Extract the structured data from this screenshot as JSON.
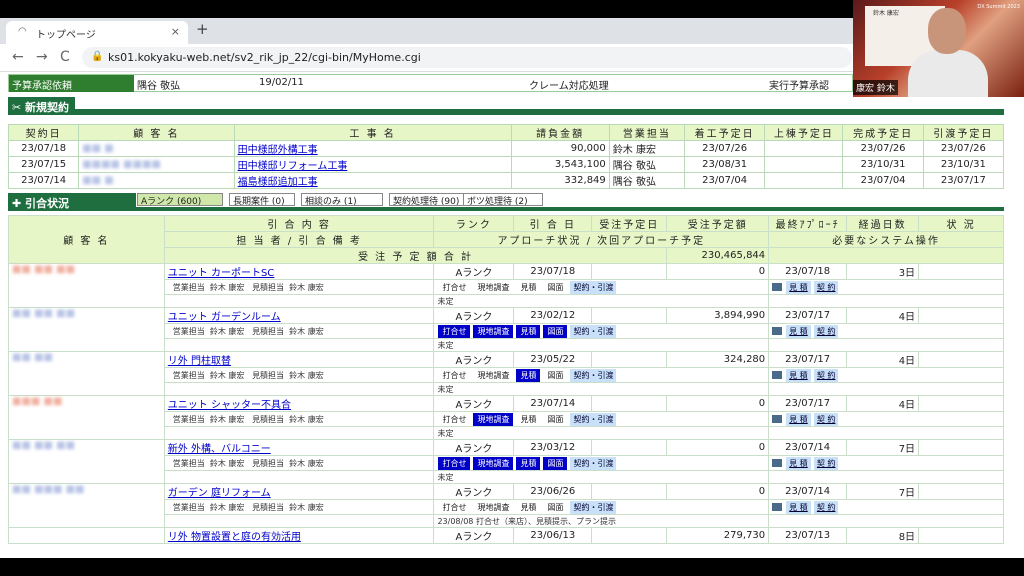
{
  "browser": {
    "tab_title": "トップページ",
    "url": "ks01.kokyaku-web.net/sv2_rik_jp_22/cgi-bin/MyHome.cgi",
    "new_tab": "+",
    "close": "×",
    "back": "←",
    "forward": "→",
    "reload": "C",
    "lock": "🔒"
  },
  "video": {
    "name": "康宏 鈴木",
    "panel_name": "鈴木 康宏",
    "event": "DX Summit 2023"
  },
  "approval_row": {
    "label": "予算承認依頼",
    "name": "隅谷 敬弘",
    "date": "19/02/11",
    "item": "クレーム対応処理",
    "status": "実行予算承認"
  },
  "new_contracts": {
    "title": "新規契約",
    "headers": [
      "契約日",
      "顧 客 名",
      "工 事 名",
      "請負金額",
      "営業担当",
      "着工予定日",
      "上棟予定日",
      "完成予定日",
      "引渡予定日"
    ],
    "rows": [
      {
        "date": "23/07/18",
        "customer": "■■ ■",
        "work": "田中様邸外構工事",
        "amount": "90,000",
        "staff": "鈴木 康宏",
        "start": "23/07/26",
        "frame": "",
        "complete": "23/07/26",
        "deliver": "23/07/26"
      },
      {
        "date": "23/07/15",
        "customer": "■■■■ ■■■■",
        "work": "田中様邸リフォーム工事",
        "amount": "3,543,100",
        "staff": "隅谷 敬弘",
        "start": "23/08/31",
        "frame": "",
        "complete": "23/10/31",
        "deliver": "23/10/31"
      },
      {
        "date": "23/07/14",
        "customer": "■■ ■",
        "work": "福島様邸追加工事",
        "amount": "332,849",
        "staff": "隅谷 敬弘",
        "start": "23/07/04",
        "frame": "",
        "complete": "23/07/04",
        "deliver": "23/07/17"
      }
    ]
  },
  "inquiry": {
    "title": "引合状況",
    "tabs": [
      "Aランク (600)",
      "長期案件 (0)",
      "相談のみ (1)",
      "契約処理待 (90)",
      "ボツ処理待 (2)"
    ],
    "h1": {
      "customer": "顧 客 名",
      "content": "引 合 内 容",
      "rank": "ランク",
      "date": "引 合 日",
      "order_date": "受注予定日",
      "order_amount": "受注予定額",
      "last_approach": "最終ｱﾌﾟﾛｰﾁ",
      "elapsed": "経過日数",
      "status": "状 況"
    },
    "h2": {
      "staff": "担 当 者 / 引 合 備 考",
      "approach": "アプローチ状況 / 次回アプローチ予定",
      "system": "必要なシステム操作"
    },
    "h3": {
      "total_label": "受 注 予 定 額 合 計",
      "total": "230,465,844"
    },
    "items": [
      {
        "customer": "■■ ■■ ■■",
        "title": "ユニット カーポートSC",
        "rank": "Aランク",
        "date": "23/07/18",
        "amount": "0",
        "last": "23/07/18",
        "days": "3日",
        "note": "未定",
        "steps": [
          "打合せ",
          "現地調査",
          "見積",
          "図面",
          "契約・引渡"
        ],
        "done": []
      },
      {
        "customer": "■■ ■■ ■■",
        "title": "ユニット ガーデンルーム",
        "rank": "Aランク",
        "date": "23/02/12",
        "amount": "3,894,990",
        "last": "23/07/17",
        "days": "4日",
        "note": "未定",
        "steps": [
          "打合せ",
          "現地調査",
          "見積",
          "図面",
          "契約・引渡"
        ],
        "done": [
          0,
          1,
          2,
          3
        ]
      },
      {
        "customer": "■■ ■■",
        "title": "リ外 門柱取替",
        "rank": "Aランク",
        "date": "23/05/22",
        "amount": "324,280",
        "last": "23/07/17",
        "days": "4日",
        "note": "未定",
        "steps": [
          "打合せ",
          "現地調査",
          "見積",
          "図面",
          "契約・引渡"
        ],
        "done": [
          2
        ]
      },
      {
        "customer": "■■■ ■■",
        "title": "ユニット シャッター不具合",
        "rank": "Aランク",
        "date": "23/07/14",
        "amount": "0",
        "last": "23/07/17",
        "days": "4日",
        "note": "未定",
        "steps": [
          "打合せ",
          "現地調査",
          "見積",
          "図面",
          "契約・引渡"
        ],
        "done": [
          1
        ]
      },
      {
        "customer": "■■ ■■ ■■",
        "title": "新外 外構、バルコニー",
        "rank": "Aランク",
        "date": "23/03/12",
        "amount": "0",
        "last": "23/07/14",
        "days": "7日",
        "note": "未定",
        "steps": [
          "打合せ",
          "現地調査",
          "見積",
          "図面",
          "契約・引渡"
        ],
        "done": [
          0,
          1,
          2,
          3
        ]
      },
      {
        "customer": "■■ ■■■ ■■",
        "title": "ガーデン 庭リフォーム",
        "rank": "Aランク",
        "date": "23/06/26",
        "amount": "0",
        "last": "23/07/14",
        "days": "7日",
        "note": "23/08/08 打合せ（来店）、見積提示、プラン提示",
        "steps": [
          "打合せ",
          "現地調査",
          "見積",
          "図面",
          "契約・引渡"
        ],
        "done": []
      }
    ],
    "last_item": {
      "title": "リ外 物置設置と庭の有効活用",
      "rank": "Aランク",
      "date": "23/06/13",
      "amount": "279,730",
      "last": "23/07/13",
      "days": "8日"
    },
    "staff_label": "営業担当",
    "staff": "鈴木 康宏",
    "est_label": "見積担当",
    "est": "鈴木 康宏",
    "btn_estimate": "見 積",
    "btn_contract": "契 約"
  }
}
